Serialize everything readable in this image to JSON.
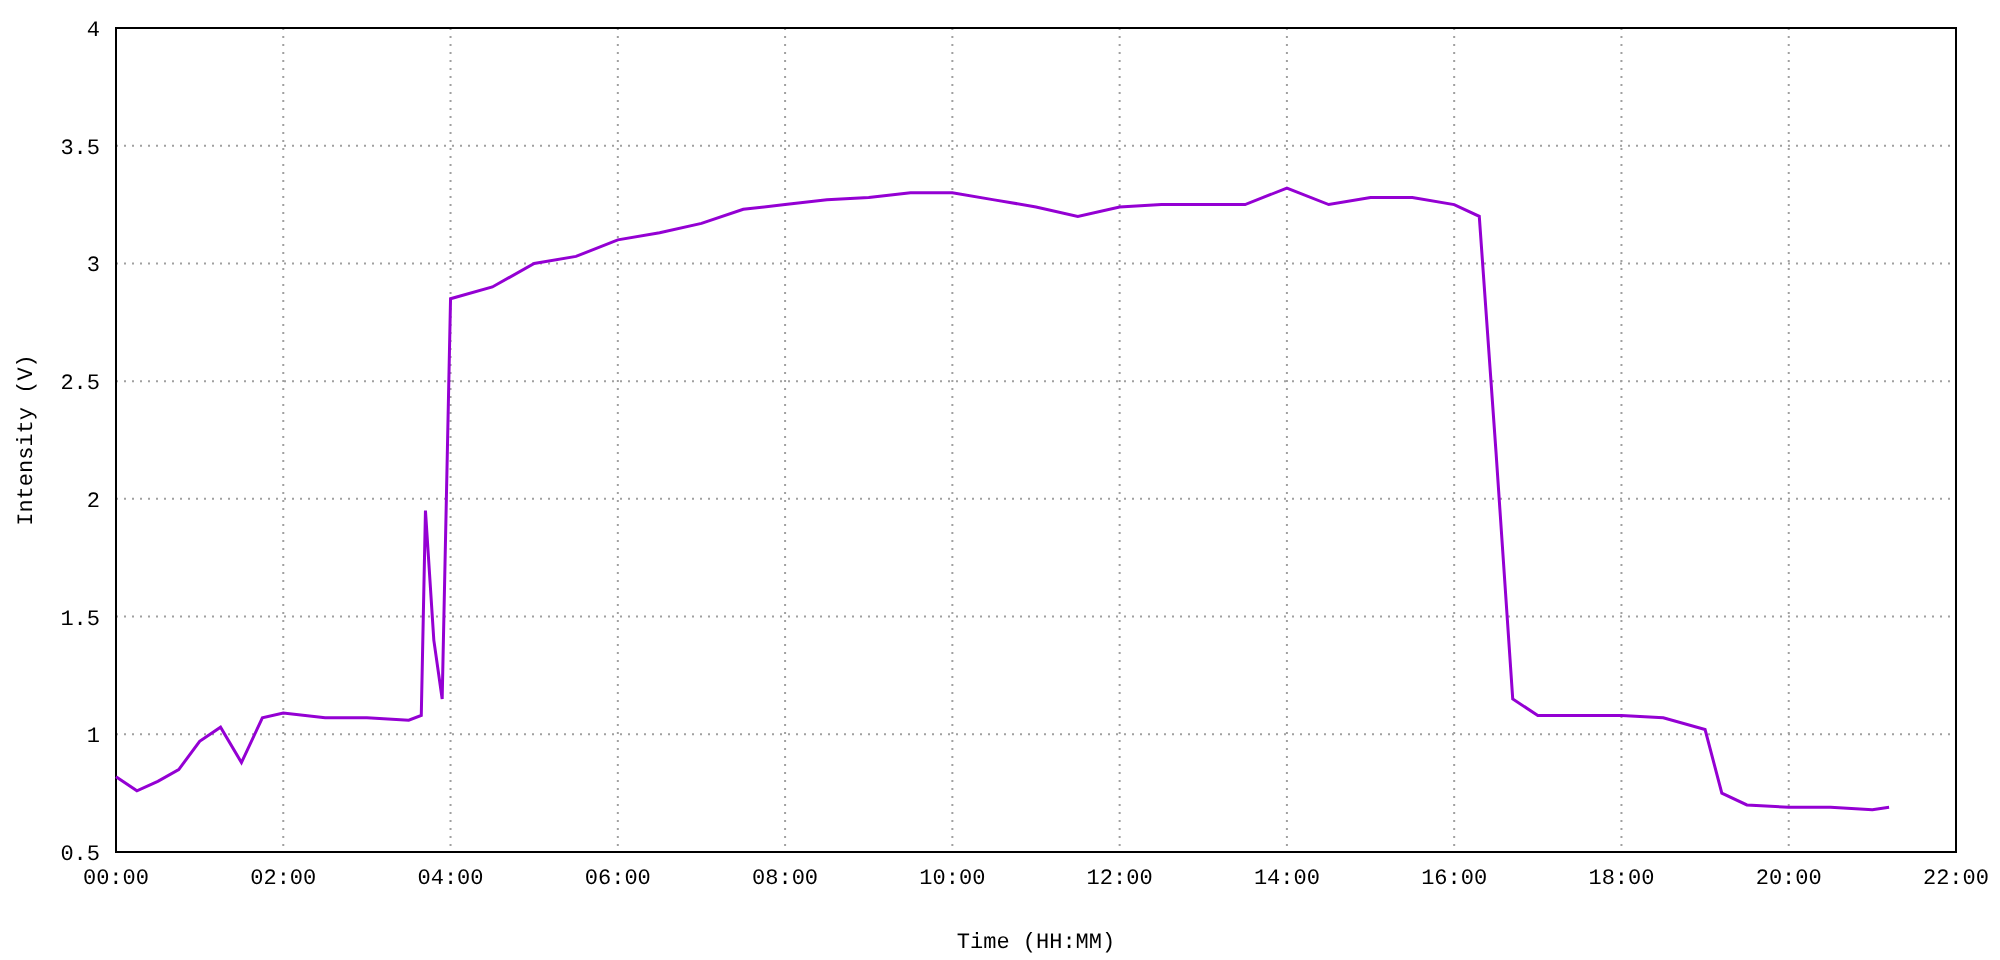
{
  "chart_data": {
    "type": "line",
    "xlabel": "Time (HH:MM)",
    "ylabel": "Intensity (V)",
    "x": [
      0,
      0.25,
      0.5,
      0.75,
      1,
      1.25,
      1.5,
      1.75,
      2,
      2.5,
      3,
      3.5,
      3.65,
      3.7,
      3.8,
      3.9,
      4,
      4.5,
      5,
      5.5,
      6,
      6.5,
      7,
      7.5,
      8,
      8.5,
      9,
      9.5,
      10,
      10.5,
      11,
      11.5,
      12,
      12.5,
      13,
      13.5,
      14,
      14.5,
      15,
      15.5,
      16,
      16.3,
      16.5,
      16.7,
      17,
      17.5,
      18,
      18.5,
      19,
      19.2,
      19.5,
      20,
      20.5,
      21,
      21.2
    ],
    "grid": true,
    "series": [
      {
        "color": "#9400d3",
        "values": [
          0.82,
          0.76,
          0.8,
          0.85,
          0.97,
          1.03,
          0.88,
          1.07,
          1.09,
          1.07,
          1.07,
          1.06,
          1.08,
          1.95,
          1.4,
          1.15,
          2.85,
          2.9,
          3.0,
          3.03,
          3.1,
          3.13,
          3.17,
          3.23,
          3.25,
          3.27,
          3.28,
          3.3,
          3.3,
          3.27,
          3.24,
          3.2,
          3.24,
          3.25,
          3.25,
          3.25,
          3.32,
          3.25,
          3.28,
          3.28,
          3.25,
          3.2,
          2.2,
          1.15,
          1.08,
          1.08,
          1.08,
          1.07,
          1.02,
          0.75,
          0.7,
          0.69,
          0.69,
          0.68,
          0.69
        ]
      }
    ],
    "xlim": [
      0,
      22
    ],
    "ylim": [
      0.5,
      4
    ],
    "xticks": [
      {
        "value": 0,
        "label": "00:00"
      },
      {
        "value": 2,
        "label": "02:00"
      },
      {
        "value": 4,
        "label": "04:00"
      },
      {
        "value": 6,
        "label": "06:00"
      },
      {
        "value": 8,
        "label": "08:00"
      },
      {
        "value": 10,
        "label": "10:00"
      },
      {
        "value": 12,
        "label": "12:00"
      },
      {
        "value": 14,
        "label": "14:00"
      },
      {
        "value": 16,
        "label": "16:00"
      },
      {
        "value": 18,
        "label": "18:00"
      },
      {
        "value": 20,
        "label": "20:00"
      },
      {
        "value": 22,
        "label": "22:00"
      }
    ],
    "yticks": [
      {
        "value": 0.5,
        "label": "0.5"
      },
      {
        "value": 1,
        "label": "1"
      },
      {
        "value": 1.5,
        "label": "1.5"
      },
      {
        "value": 2,
        "label": "2"
      },
      {
        "value": 2.5,
        "label": "2.5"
      },
      {
        "value": 3,
        "label": "3"
      },
      {
        "value": 3.5,
        "label": "3.5"
      },
      {
        "value": 4,
        "label": "4"
      }
    ]
  }
}
